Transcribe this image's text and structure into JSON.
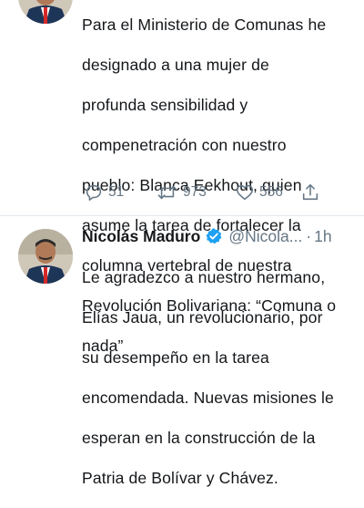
{
  "top_tweet": {
    "text_lines": [
      "Para el Ministerio de Comunas he",
      "designado a una mujer de",
      "profunda sensibilidad y",
      "compenetración con nuestro",
      "pueblo: Blanca Eekhout, quien",
      "asume la tarea de fortalecer la",
      "columna vertebral de nuestra",
      "Revolución Bolivariana: “Comuna o",
      "nada”"
    ],
    "actions": {
      "reply_icon": "reply-icon",
      "reply_count": "51",
      "retweet_icon": "retweet-icon",
      "retweet_count": "973",
      "like_icon": "heart-icon",
      "like_count": "556",
      "share_icon": "share-icon"
    }
  },
  "second_tweet": {
    "author_name": "Nicolás Maduro",
    "verified_icon": "verified-badge-icon",
    "handle": "@Nicola...",
    "separator": "·",
    "time": "1h",
    "text_lines": [
      "Le agradezco a nuestro hermano,",
      "Elías Jaua, un revolucionario, por",
      "su desempeño en la tarea",
      "encomendada. Nuevas misiones le",
      "esperan en la construcción de la",
      "Patria de Bolívar y Chávez."
    ]
  },
  "colors": {
    "text": "#14171a",
    "secondary": "#657786",
    "verified": "#1da1f2",
    "divider": "#e1e8ed"
  }
}
